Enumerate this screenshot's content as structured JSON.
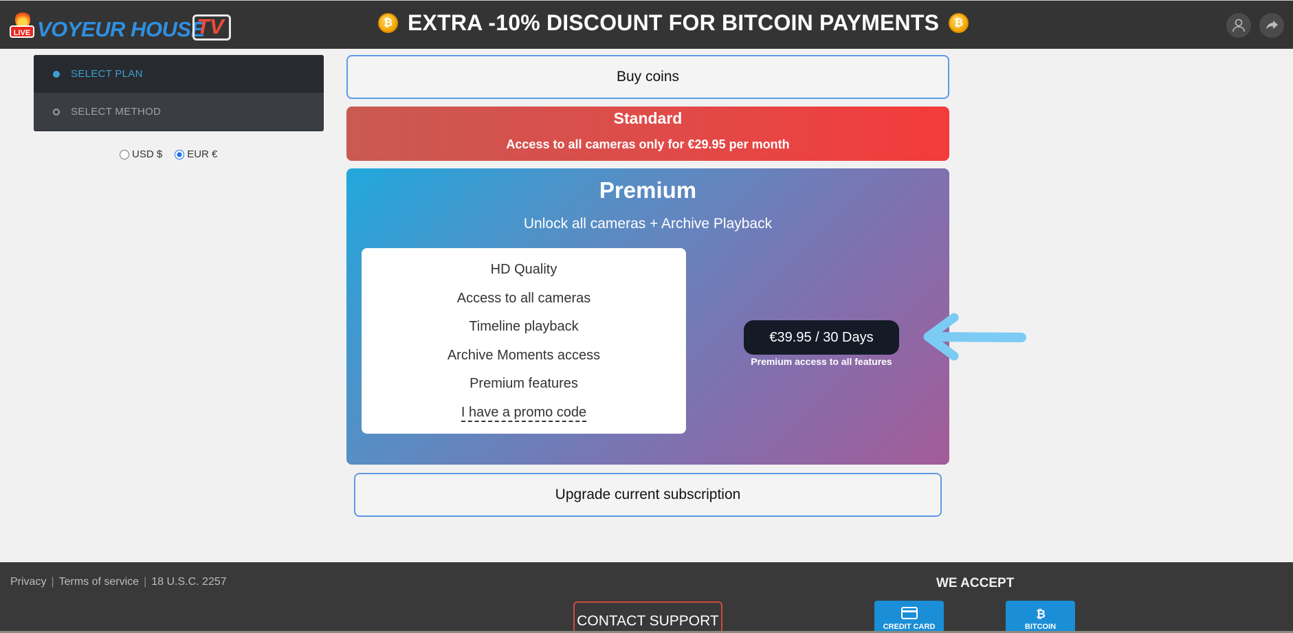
{
  "header": {
    "logo_badge": "LIVE",
    "logo_text": "VOYEUR HOUSE",
    "logo_tv": "TV",
    "banner": "EXTRA -10% DISCOUNT FOR BITCOIN PAYMENTS",
    "coin_symbol": "₿"
  },
  "steps": [
    {
      "label": "SELECT PLAN"
    },
    {
      "label": "SELECT METHOD"
    }
  ],
  "currency": {
    "usd_label": "USD $",
    "eur_label": "EUR €",
    "selected": "EUR €"
  },
  "buy_coins": "Buy coins",
  "standard": {
    "title": "Standard",
    "subtitle": "Access to all cameras only for €29.95 per month"
  },
  "premium": {
    "title": "Premium",
    "subtitle": "Unlock all cameras + Archive Playback",
    "features": [
      "HD Quality",
      "Access to all cameras",
      "Timeline playback",
      "Archive Moments access",
      "Premium features"
    ],
    "promo": "I have a promo code",
    "price_button": "€39.95 / 30 Days",
    "price_note": "Premium access to all features"
  },
  "upgrade": "Upgrade current subscription",
  "footer": {
    "links": [
      "Privacy",
      "Terms of service",
      "18 U.S.C. 2257"
    ],
    "contact": "CONTACT SUPPORT",
    "we_accept": "WE ACCEPT",
    "pay_card": "CREDIT CARD",
    "pay_bitcoin": "BITCOIN"
  },
  "colors": {
    "header_bg": "#343434",
    "accent_blue": "#3c9fd1",
    "standard_red": "#e04a48",
    "premium_start": "#21a8dc",
    "premium_end": "#a35c98",
    "arrow": "#7ccbf4"
  }
}
